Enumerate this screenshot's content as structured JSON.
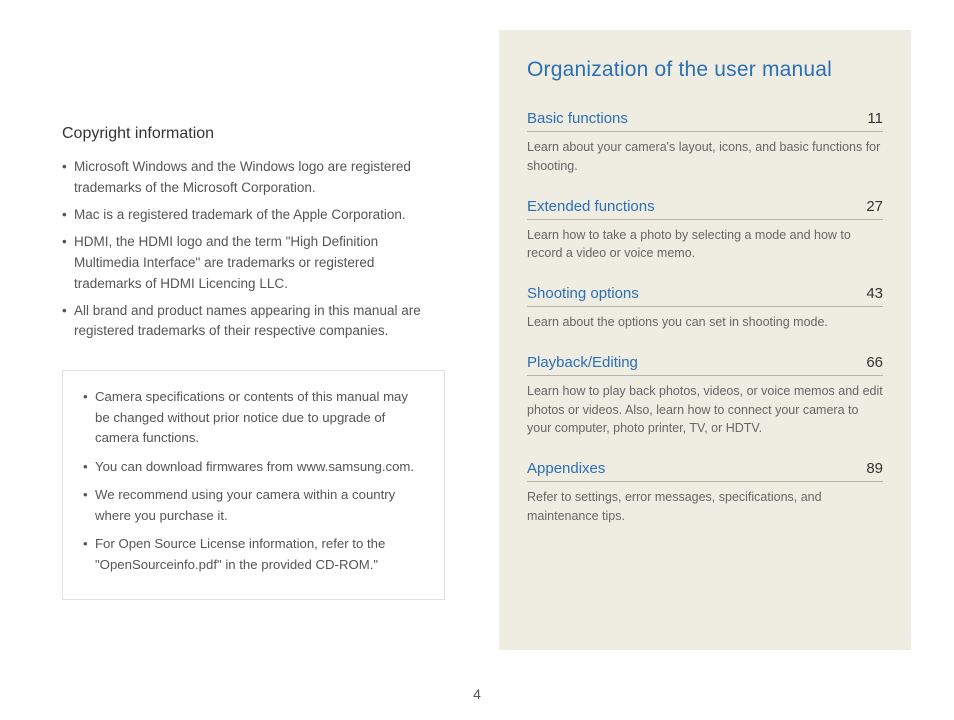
{
  "page_number": "4",
  "left": {
    "heading": "Copyright information",
    "bullets": [
      "Microsoft Windows and the Windows logo are registered trademarks of the Microsoft Corporation.",
      "Mac is a registered trademark of the Apple Corporation.",
      "HDMI, the HDMI logo and the term \"High Definition Multimedia Interface\" are trademarks or registered trademarks of HDMI Licencing LLC.",
      "All brand and product names appearing in this manual are registered trademarks of their respective companies."
    ],
    "note_bullets": [
      "Camera specifications or contents of this manual may be changed without prior notice due to upgrade of camera functions.",
      "You can download firmwares from www.samsung.com.",
      "We recommend using your camera within a country where you purchase it.",
      "For Open Source License information, refer to the \"OpenSourceinfo.pdf\" in the provided CD-ROM.\""
    ]
  },
  "right": {
    "title": "Organization of the user manual",
    "sections": [
      {
        "title": "Basic functions",
        "page": "11",
        "desc": "Learn about your camera's layout, icons, and basic functions for shooting."
      },
      {
        "title": "Extended functions",
        "page": "27",
        "desc": "Learn how to take a photo by selecting a mode and how to record a video or voice memo."
      },
      {
        "title": "Shooting options",
        "page": "43",
        "desc": "Learn about the options you can set in shooting mode."
      },
      {
        "title": "Playback/Editing",
        "page": "66",
        "desc": "Learn how to play back photos, videos, or voice memos and edit photos or videos. Also, learn how to connect your camera to your computer, photo printer, TV, or HDTV."
      },
      {
        "title": "Appendixes",
        "page": "89",
        "desc": "Refer to settings, error messages, specifications, and maintenance tips."
      }
    ]
  }
}
